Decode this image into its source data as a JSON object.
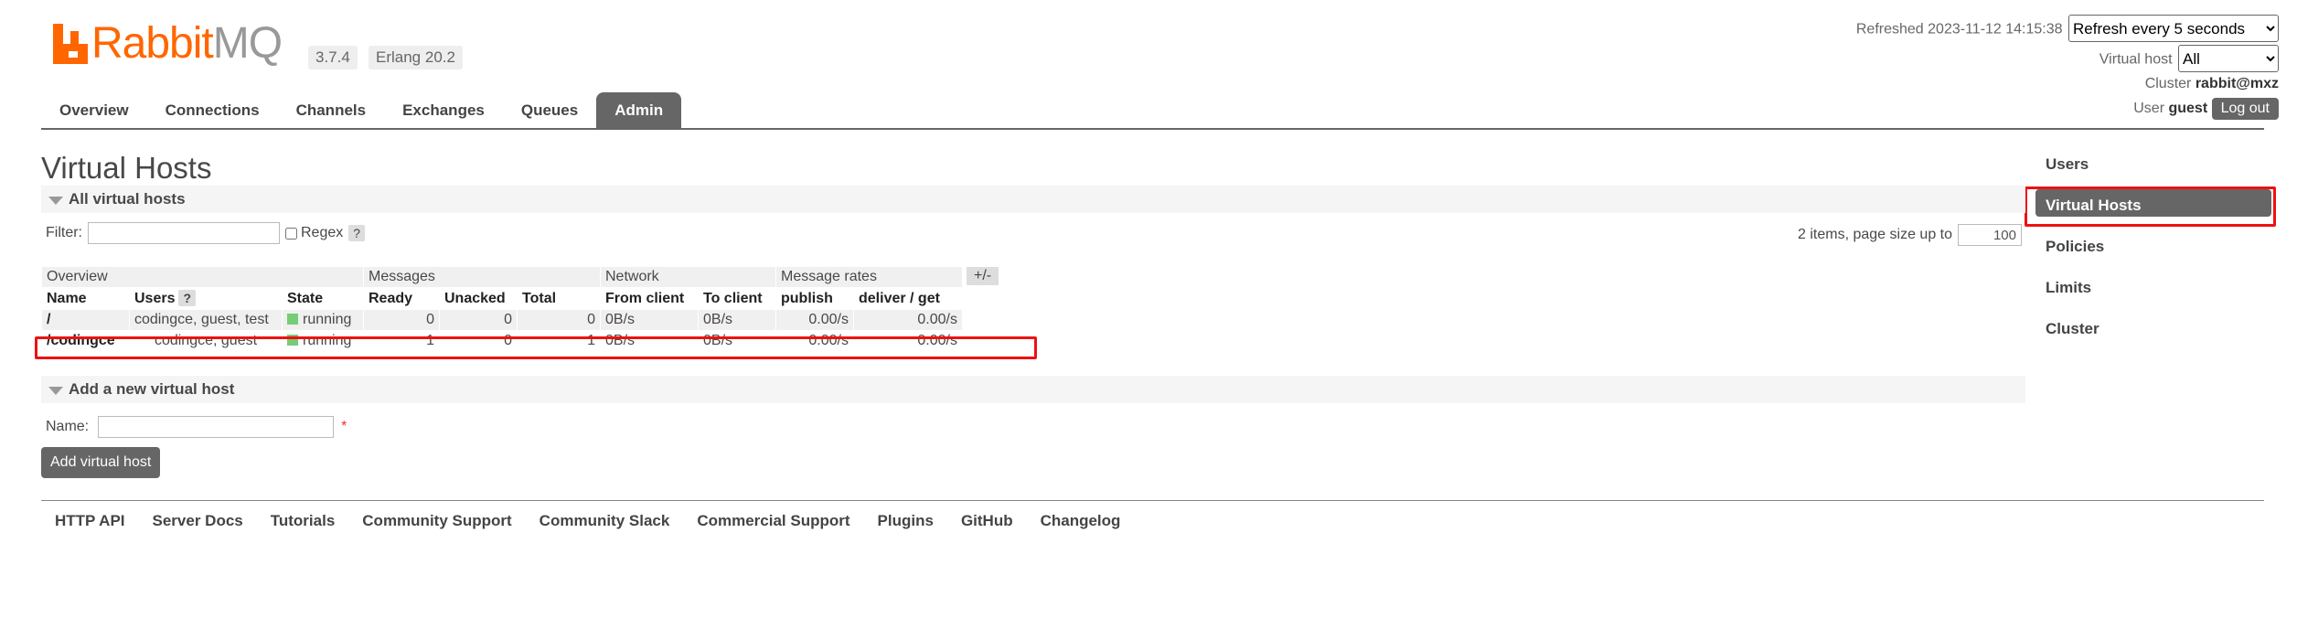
{
  "header": {
    "logo": {
      "part1": "Rabbit",
      "part2": "MQ"
    },
    "version": "3.7.4",
    "erlang": "Erlang 20.2",
    "refreshed_label": "Refreshed",
    "refreshed_time": "2023-11-12 14:15:38",
    "refresh_select": "Refresh every 5 seconds",
    "vhost_label": "Virtual host",
    "vhost_select": "All",
    "cluster_label": "Cluster",
    "cluster_value": "rabbit@mxz",
    "user_label": "User",
    "user_value": "guest",
    "logout": "Log out"
  },
  "tabs": [
    {
      "label": "Overview"
    },
    {
      "label": "Connections"
    },
    {
      "label": "Channels"
    },
    {
      "label": "Exchanges"
    },
    {
      "label": "Queues"
    },
    {
      "label": "Admin",
      "active": true
    }
  ],
  "sidebar": [
    {
      "label": "Users"
    },
    {
      "label": "Virtual Hosts",
      "active": true
    },
    {
      "label": "Policies"
    },
    {
      "label": "Limits"
    },
    {
      "label": "Cluster"
    }
  ],
  "main": {
    "title": "Virtual Hosts",
    "all_section": "All virtual hosts",
    "filter_label": "Filter:",
    "regex_label": "Regex",
    "help": "?",
    "page_size_label": "2 items, page size up to",
    "page_size_value": "100",
    "plus_minus": "+/-",
    "groups": [
      "Overview",
      "Messages",
      "Network",
      "Message rates"
    ],
    "columns": [
      "Name",
      "Users",
      "State",
      "Ready",
      "Unacked",
      "Total",
      "From client",
      "To client",
      "publish",
      "deliver / get"
    ],
    "rows": [
      {
        "name": "/",
        "users": "codingce, guest, test",
        "state": "running",
        "ready": "0",
        "unacked": "0",
        "total": "0",
        "from_client": "0B/s",
        "to_client": "0B/s",
        "publish": "0.00/s",
        "deliver": "0.00/s"
      },
      {
        "name": "/codingce",
        "users": "codingce, guest",
        "state": "running",
        "ready": "1",
        "unacked": "0",
        "total": "1",
        "from_client": "0B/s",
        "to_client": "0B/s",
        "publish": "0.00/s",
        "deliver": "0.00/s"
      }
    ],
    "add_section": "Add a new virtual host",
    "name_label": "Name:",
    "required": "*",
    "add_button": "Add virtual host"
  },
  "footer": [
    "HTTP API",
    "Server Docs",
    "Tutorials",
    "Community Support",
    "Community Slack",
    "Commercial Support",
    "Plugins",
    "GitHub",
    "Changelog"
  ],
  "colors": {
    "brand": "#ff6600",
    "highlight": "#ee1111",
    "nav": "#666666",
    "running": "#77cc77"
  }
}
